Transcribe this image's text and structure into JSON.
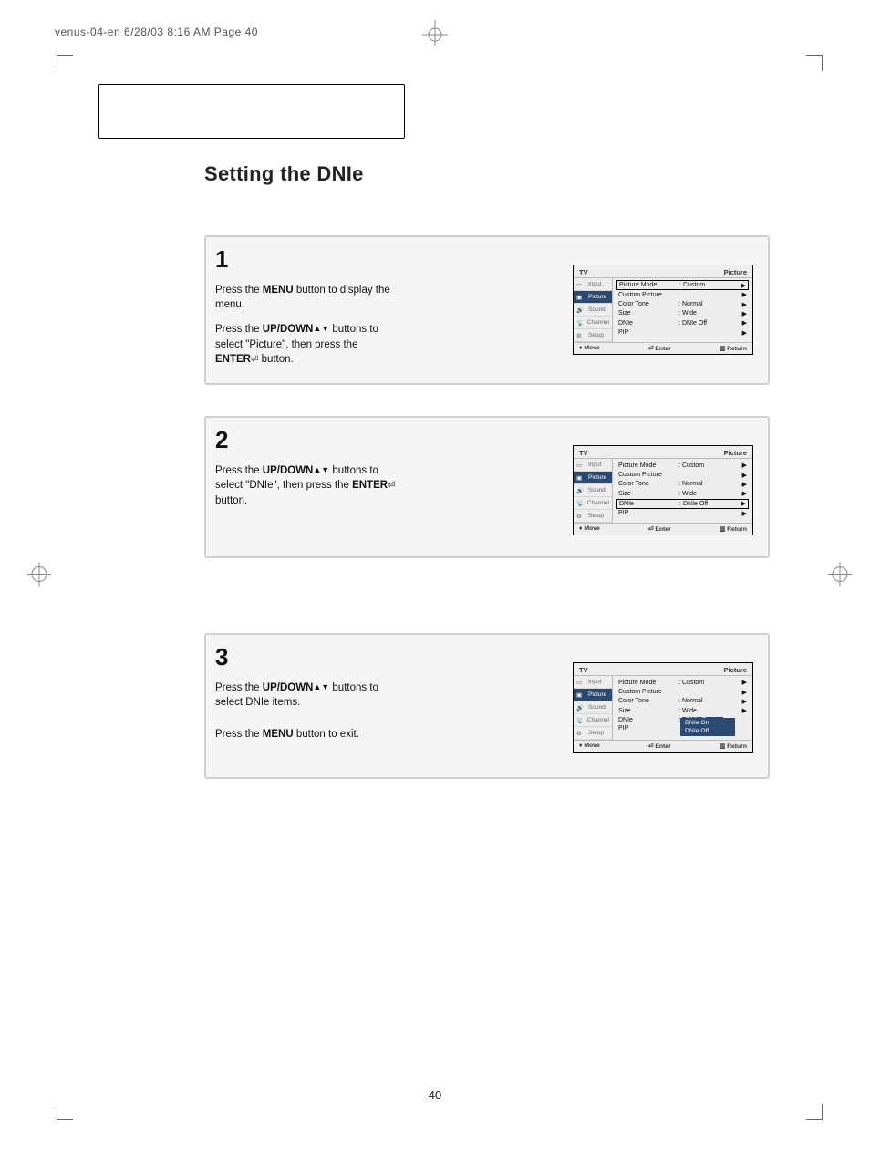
{
  "header_strip": "venus-04-en  6/28/03 8:16 AM  Page 40",
  "title": "Setting the DNIe",
  "page_number": "40",
  "steps": {
    "s1": {
      "num": "1",
      "line1a": "Press the ",
      "line1b": "MENU",
      "line1c": " button to display the menu.",
      "line2a": "Press the ",
      "line2b": "UP/DOWN",
      "line2c": " buttons to select \"Picture\", then press the ",
      "line2d": "ENTER",
      "line2e": " button."
    },
    "s2": {
      "num": "2",
      "line1a": "Press the ",
      "line1b": "UP/DOWN",
      "line1c": " buttons to select \"DNIe\", then press the ",
      "line1d": "ENTER",
      "line1e": " button."
    },
    "s3": {
      "num": "3",
      "line1a": "Press the ",
      "line1b": "UP/DOWN",
      "line1c": " buttons to select DNIe items.",
      "line2a": "Press the ",
      "line2b": "MENU",
      "line2c": " button to exit."
    }
  },
  "osd": {
    "tv": "TV",
    "section": "Picture",
    "tabs": {
      "input": "Input",
      "picture": "Picture",
      "sound": "Sound",
      "channel": "Channel",
      "setup": "Setup"
    },
    "rows": {
      "picture_mode": {
        "lbl": "Picture Mode",
        "val": "Custom"
      },
      "custom_picture": {
        "lbl": "Custom Picture",
        "val": ""
      },
      "color_tone": {
        "lbl": "Color Tone",
        "val": "Normal"
      },
      "size": {
        "lbl": "Size",
        "val": "Wide"
      },
      "dnie": {
        "lbl": "DNIe",
        "val": "DNIe Off"
      },
      "pip": {
        "lbl": "PIP",
        "val": ""
      }
    },
    "dropdown": {
      "demo": "DNIe Demo",
      "on": "DNIe On",
      "off": "DNIe Off"
    },
    "footer": {
      "move": "Move",
      "enter": "Enter",
      "return": "Return"
    }
  }
}
